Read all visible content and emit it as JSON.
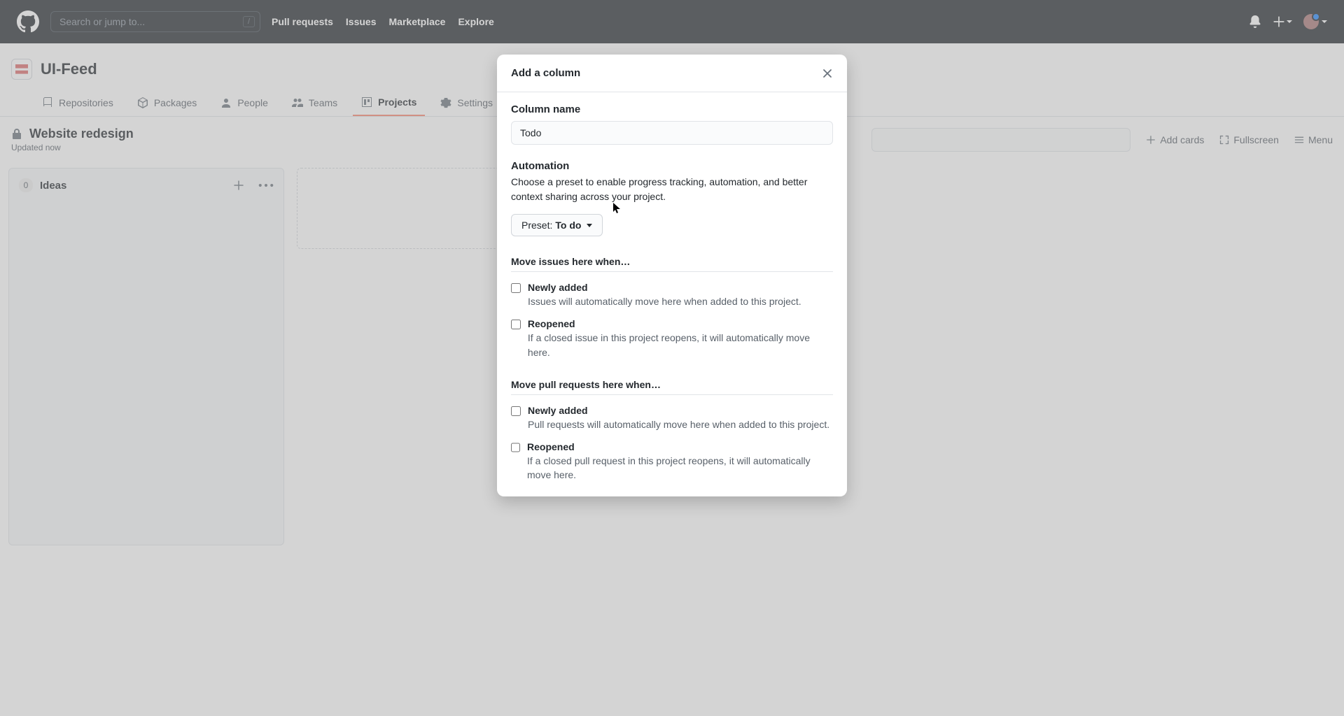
{
  "header": {
    "search_placeholder": "Search or jump to...",
    "slash": "/",
    "nav": {
      "pulls": "Pull requests",
      "issues": "Issues",
      "marketplace": "Marketplace",
      "explore": "Explore"
    }
  },
  "org": {
    "name": "UI-Feed",
    "tabs": {
      "repositories": "Repositories",
      "packages": "Packages",
      "people": "People",
      "teams": "Teams",
      "projects": "Projects",
      "settings": "Settings"
    }
  },
  "project": {
    "title": "Website redesign",
    "updated": "Updated now",
    "actions": {
      "add_cards": "Add cards",
      "fullscreen": "Fullscreen",
      "menu": "Menu"
    },
    "column1": {
      "count": "0",
      "name": "Ideas"
    }
  },
  "modal": {
    "title": "Add a column",
    "column_name_label": "Column name",
    "column_name_value": "Todo",
    "automation_heading": "Automation",
    "automation_desc": "Choose a preset to enable progress tracking, automation, and better context sharing across your project.",
    "preset_prefix": "Preset: ",
    "preset_value": "To do",
    "issues_heading": "Move issues here when…",
    "prs_heading": "Move pull requests here when…",
    "rules": {
      "iss_new_t": "Newly added",
      "iss_new_d": "Issues will automatically move here when added to this project.",
      "iss_reop_t": "Reopened",
      "iss_reop_d": "If a closed issue in this project reopens, it will automatically move here.",
      "pr_new_t": "Newly added",
      "pr_new_d": "Pull requests will automatically move here when added to this project.",
      "pr_reop_t": "Reopened",
      "pr_reop_d": "If a closed pull request in this project reopens, it will automatically move here."
    }
  }
}
